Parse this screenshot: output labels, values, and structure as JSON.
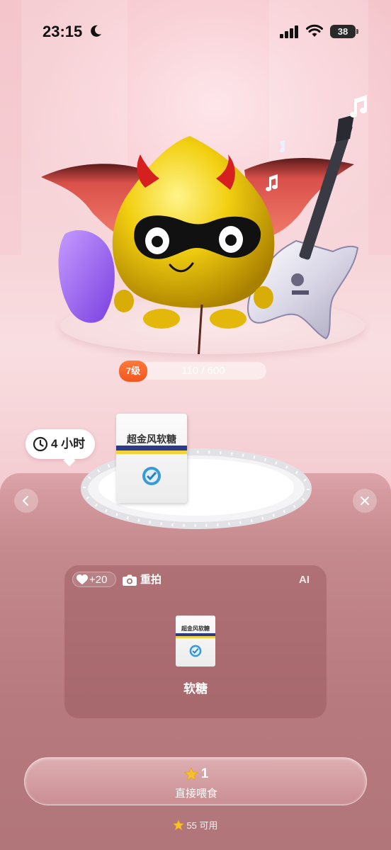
{
  "status_bar": {
    "time": "23:15",
    "battery": "38"
  },
  "pet": {
    "level_label": "7级",
    "xp_text": "110 / 600",
    "xp_current": 110,
    "xp_max": 600
  },
  "timer": {
    "label": "4 小时"
  },
  "food": {
    "package_text": "超金风软糖",
    "likes": "+20",
    "retake_label": "重拍",
    "ai_tag": "AI",
    "name": "软糖"
  },
  "feed": {
    "cost": "1",
    "button_label": "直接喂食",
    "balance_text": "55 可用"
  },
  "colors": {
    "accent_orange": "#f2561f",
    "star_gold": "#f6c12f",
    "sheet_bg": "#b77a7e"
  }
}
